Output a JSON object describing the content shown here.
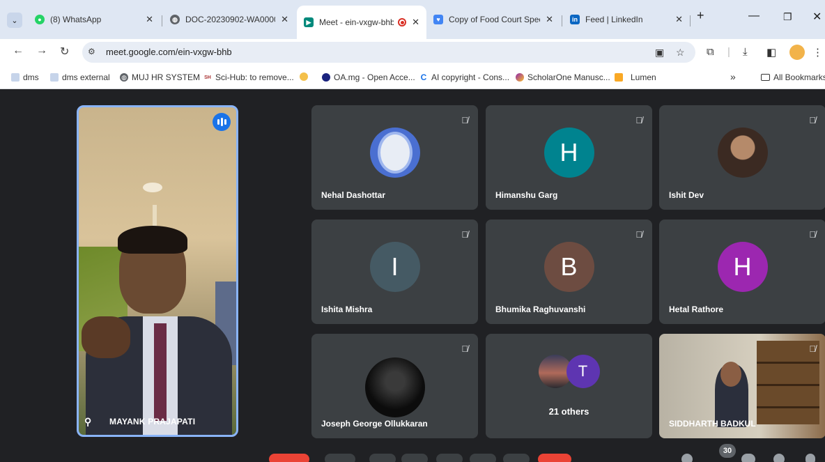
{
  "browser": {
    "tabs": [
      {
        "title": "(8) WhatsApp",
        "favicon_color": "#25d366",
        "favicon_icon": "whatsapp-icon",
        "active": false
      },
      {
        "title": "DOC-20230902-WA0000",
        "favicon_color": "#5f6368",
        "favicon_icon": "globe-icon",
        "active": false
      },
      {
        "title": "Meet - ein-vxgw-bhb",
        "favicon_color": "#00897b",
        "favicon_icon": "meet-icon",
        "active": true,
        "recording": true
      },
      {
        "title": "Copy of Food Court Spec",
        "favicon_color": "#4285f4",
        "favicon_icon": "forms-icon",
        "active": false
      },
      {
        "title": "Feed | LinkedIn",
        "favicon_color": "#0a66c2",
        "favicon_icon": "linkedin-icon",
        "active": false
      }
    ],
    "new_tab": "+",
    "url": "meet.google.com/ein-vxgw-bhb",
    "bookmarks": [
      {
        "label": "dms",
        "icon": "document-icon"
      },
      {
        "label": "dms external",
        "icon": "document-icon"
      },
      {
        "label": "MUJ HR SYSTEM",
        "icon": "globe-icon"
      },
      {
        "label": "Sci-Hub: to remove...",
        "icon": "scihub-icon"
      },
      {
        "label": "",
        "icon": "bird-icon"
      },
      {
        "label": "OA.mg - Open Acce...",
        "icon": "circle-icon"
      },
      {
        "label": "AI copyright - Cons...",
        "icon": "c-icon"
      },
      {
        "label": "ScholarOne Manusc...",
        "icon": "scholarone-icon"
      },
      {
        "label": "Lumen",
        "icon": "lumen-icon"
      }
    ],
    "more_bookmarks": "»",
    "all_bookmarks": "All Bookmarks"
  },
  "meet": {
    "main_speaker": {
      "name": "MAYANK PRAJAPATI"
    },
    "participants": [
      {
        "name": "Nehal Dashottar",
        "initial": "",
        "avatar": "image",
        "avatar_color": "#4a6fd1"
      },
      {
        "name": "Himanshu Garg",
        "initial": "H",
        "avatar": "initial",
        "avatar_color": "#00838f"
      },
      {
        "name": "Ishit Dev",
        "initial": "",
        "avatar": "image",
        "avatar_color": "#6b5142"
      },
      {
        "name": "Ishita Mishra",
        "initial": "I",
        "avatar": "initial",
        "avatar_color": "#455a64"
      },
      {
        "name": "Bhumika Raghuvanshi",
        "initial": "B",
        "avatar": "initial",
        "avatar_color": "#6d4c41"
      },
      {
        "name": "Hetal Rathore",
        "initial": "H",
        "avatar": "initial",
        "avatar_color": "#9c27b0"
      },
      {
        "name": "Joseph George Ollukkaran",
        "initial": "",
        "avatar": "image",
        "avatar_color": "#111111"
      }
    ],
    "others": {
      "label": "21 others",
      "initial": "T"
    },
    "camera_tile": {
      "name": "SIDDHARTH BADKUL"
    },
    "participant_count": "30"
  }
}
